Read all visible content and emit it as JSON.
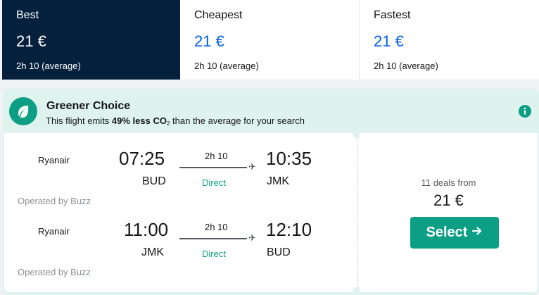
{
  "tabs": [
    {
      "label": "Best",
      "price": "21 €",
      "duration": "2h 10 (average)"
    },
    {
      "label": "Cheapest",
      "price": "21 €",
      "duration": "2h 10 (average)"
    },
    {
      "label": "Fastest",
      "price": "21 €",
      "duration": "2h 10 (average)"
    }
  ],
  "greener": {
    "title": "Greener Choice",
    "desc_prefix": "This flight emits ",
    "desc_bold": "49% less CO",
    "desc_sub": "2",
    "desc_suffix": " than the average for your search",
    "icon": "leaf-icon",
    "info_icon": "info-icon"
  },
  "legs": [
    {
      "airline": "Ryanair",
      "depart_time": "07:25",
      "depart_code": "BUD",
      "duration": "2h 10",
      "stops": "Direct",
      "arrive_time": "10:35",
      "arrive_code": "JMK",
      "operated_by": "Operated by Buzz"
    },
    {
      "airline": "Ryanair",
      "depart_time": "11:00",
      "depart_code": "JMK",
      "duration": "2h 10",
      "stops": "Direct",
      "arrive_time": "12:10",
      "arrive_code": "BUD",
      "operated_by": "Operated by Buzz"
    }
  ],
  "pricing": {
    "deals": "11 deals from",
    "price": "21 €",
    "select_label": "Select"
  },
  "colors": {
    "best_tab_bg": "#05203c",
    "price_blue": "#0062e3",
    "green_accent": "#0c9f86",
    "green_banner_bg": "#dff3ee"
  }
}
